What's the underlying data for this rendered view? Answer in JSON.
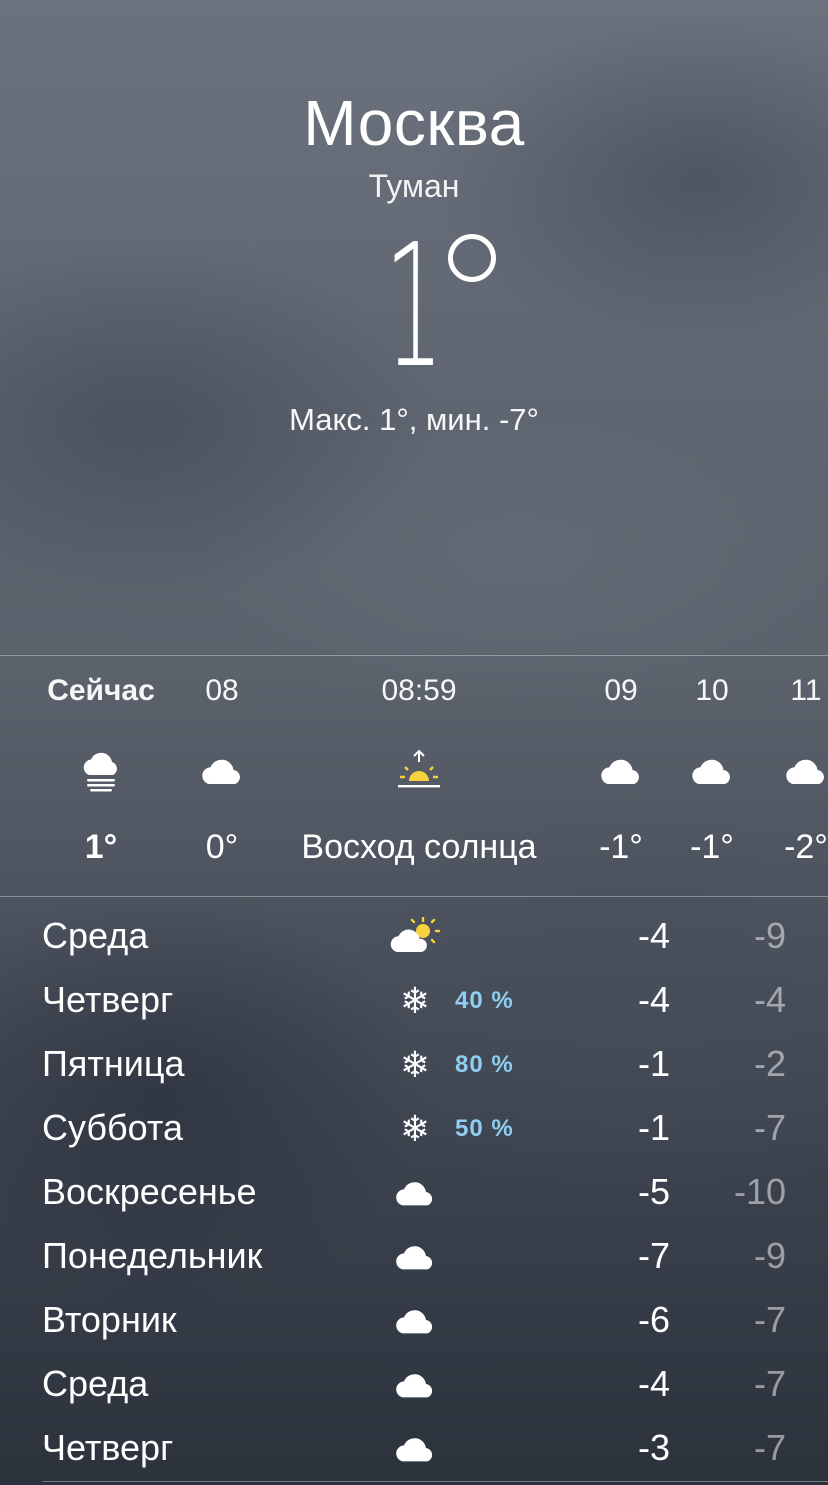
{
  "location": {
    "city": "Москва",
    "condition": "Туман",
    "temperature": "1",
    "hilo": "Макс. 1°, мин. -7°"
  },
  "hourly": [
    {
      "time": "Сейчас",
      "icon": "fog-icon",
      "temp": "1°",
      "bold": true
    },
    {
      "time": "08",
      "icon": "cloud-icon",
      "temp": "0°"
    },
    {
      "time": "08:59",
      "icon": "sunrise-icon",
      "temp": "Восход солнца"
    },
    {
      "time": "09",
      "icon": "cloud-icon",
      "temp": "-1°"
    },
    {
      "time": "10",
      "icon": "cloud-icon",
      "temp": "-1°"
    },
    {
      "time": "11",
      "icon": "cloud-icon",
      "temp": "-2°"
    }
  ],
  "daily": [
    {
      "day": "Среда",
      "icon": "partly-sunny-icon",
      "precip": "",
      "max": "-4",
      "min": "-9"
    },
    {
      "day": "Четверг",
      "icon": "snowflake-icon",
      "precip": "40 %",
      "max": "-4",
      "min": "-4"
    },
    {
      "day": "Пятница",
      "icon": "snowflake-icon",
      "precip": "80 %",
      "max": "-1",
      "min": "-2"
    },
    {
      "day": "Суббота",
      "icon": "snowflake-icon",
      "precip": "50 %",
      "max": "-1",
      "min": "-7"
    },
    {
      "day": "Воскресенье",
      "icon": "cloud-icon",
      "precip": "",
      "max": "-5",
      "min": "-10"
    },
    {
      "day": "Понедельник",
      "icon": "cloud-icon",
      "precip": "",
      "max": "-7",
      "min": "-9"
    },
    {
      "day": "Вторник",
      "icon": "cloud-icon",
      "precip": "",
      "max": "-6",
      "min": "-7"
    },
    {
      "day": "Среда",
      "icon": "cloud-icon",
      "precip": "",
      "max": "-4",
      "min": "-7"
    },
    {
      "day": "Четверг",
      "icon": "cloud-icon",
      "precip": "",
      "max": "-3",
      "min": "-7"
    }
  ],
  "colors": {
    "precip": "#8fcdf2",
    "sun": "#f7d23c"
  }
}
